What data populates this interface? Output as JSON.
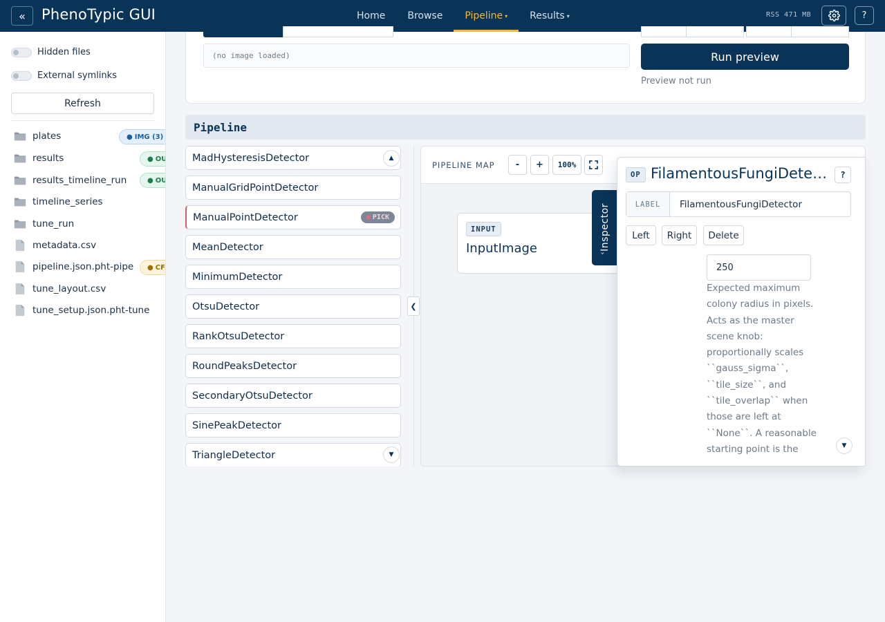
{
  "app": {
    "title": "PhenoTypic GUI",
    "collapse_glyph": "«"
  },
  "nav": {
    "items": [
      {
        "label": "Home"
      },
      {
        "label": "Browse"
      },
      {
        "label": "Pipeline",
        "caret": "▾"
      },
      {
        "label": "Results",
        "caret": "▾"
      }
    ],
    "rss": "RSS 471 MB",
    "help_label": "?",
    "accent_color": "#f7b731",
    "bar_color": "#0a3358"
  },
  "sidebar": {
    "toggles": [
      {
        "label": "Hidden files",
        "on": false
      },
      {
        "label": "External symlinks",
        "on": false
      }
    ],
    "refresh_label": "Refresh",
    "files": [
      {
        "name": "plates",
        "kind": "folder",
        "badge": "IMG (3)",
        "badge_type": "img"
      },
      {
        "name": "results",
        "kind": "folder",
        "badge": "OUT",
        "badge_type": "out"
      },
      {
        "name": "results_timeline_run",
        "kind": "folder",
        "badge": "OUT",
        "badge_type": "out"
      },
      {
        "name": "timeline_series",
        "kind": "folder"
      },
      {
        "name": "tune_run",
        "kind": "folder"
      },
      {
        "name": "metadata.csv",
        "kind": "file"
      },
      {
        "name": "pipeline.json.pht-pipe",
        "kind": "file",
        "badge": "CFG",
        "badge_type": "cfg"
      },
      {
        "name": "tune_layout.csv",
        "kind": "file"
      },
      {
        "name": "tune_setup.json.pht-tune",
        "kind": "file"
      }
    ]
  },
  "preview": {
    "image_placeholder": "(no image loaded)",
    "run_label": "Run preview",
    "status": "Preview not run"
  },
  "pipeline": {
    "header": "Pipeline",
    "operations": [
      {
        "name": "MadHysteresisDetector"
      },
      {
        "name": "ManualGridPointDetector"
      },
      {
        "name": "ManualPointDetector",
        "badge": "PICK"
      },
      {
        "name": "MeanDetector"
      },
      {
        "name": "MinimumDetector"
      },
      {
        "name": "OtsuDetector"
      },
      {
        "name": "RankOtsuDetector"
      },
      {
        "name": "RoundPeaksDetector"
      },
      {
        "name": "SecondaryOtsuDetector"
      },
      {
        "name": "SinePeakDetector"
      },
      {
        "name": "TriangleDetector"
      }
    ],
    "collapse_glyph": "❮"
  },
  "map": {
    "label": "PIPELINE MAP",
    "zoom_out": "-",
    "zoom_in": "+",
    "zoom_level": "100%",
    "node": {
      "tag": "INPUT",
      "title": "InputImage"
    }
  },
  "inspector": {
    "tab_label": "Inspector",
    "tab_chevron": "›",
    "op_tag": "OP",
    "title": "FilamentousFungiDetector",
    "help_label": "?",
    "label_key": "LABEL",
    "label_value": "FilamentousFungiDetector",
    "buttons": {
      "left": "Left",
      "right": "Right",
      "delete": "Delete"
    },
    "param_value": "250",
    "param_description": "Expected maximum colony radius in pixels. Acts as the master scene knob: proportionally scales ``gauss_sigma``, ``tile_size``, and ``tile_overlap`` when those are left at ``None``. A reasonable starting point is the"
  }
}
